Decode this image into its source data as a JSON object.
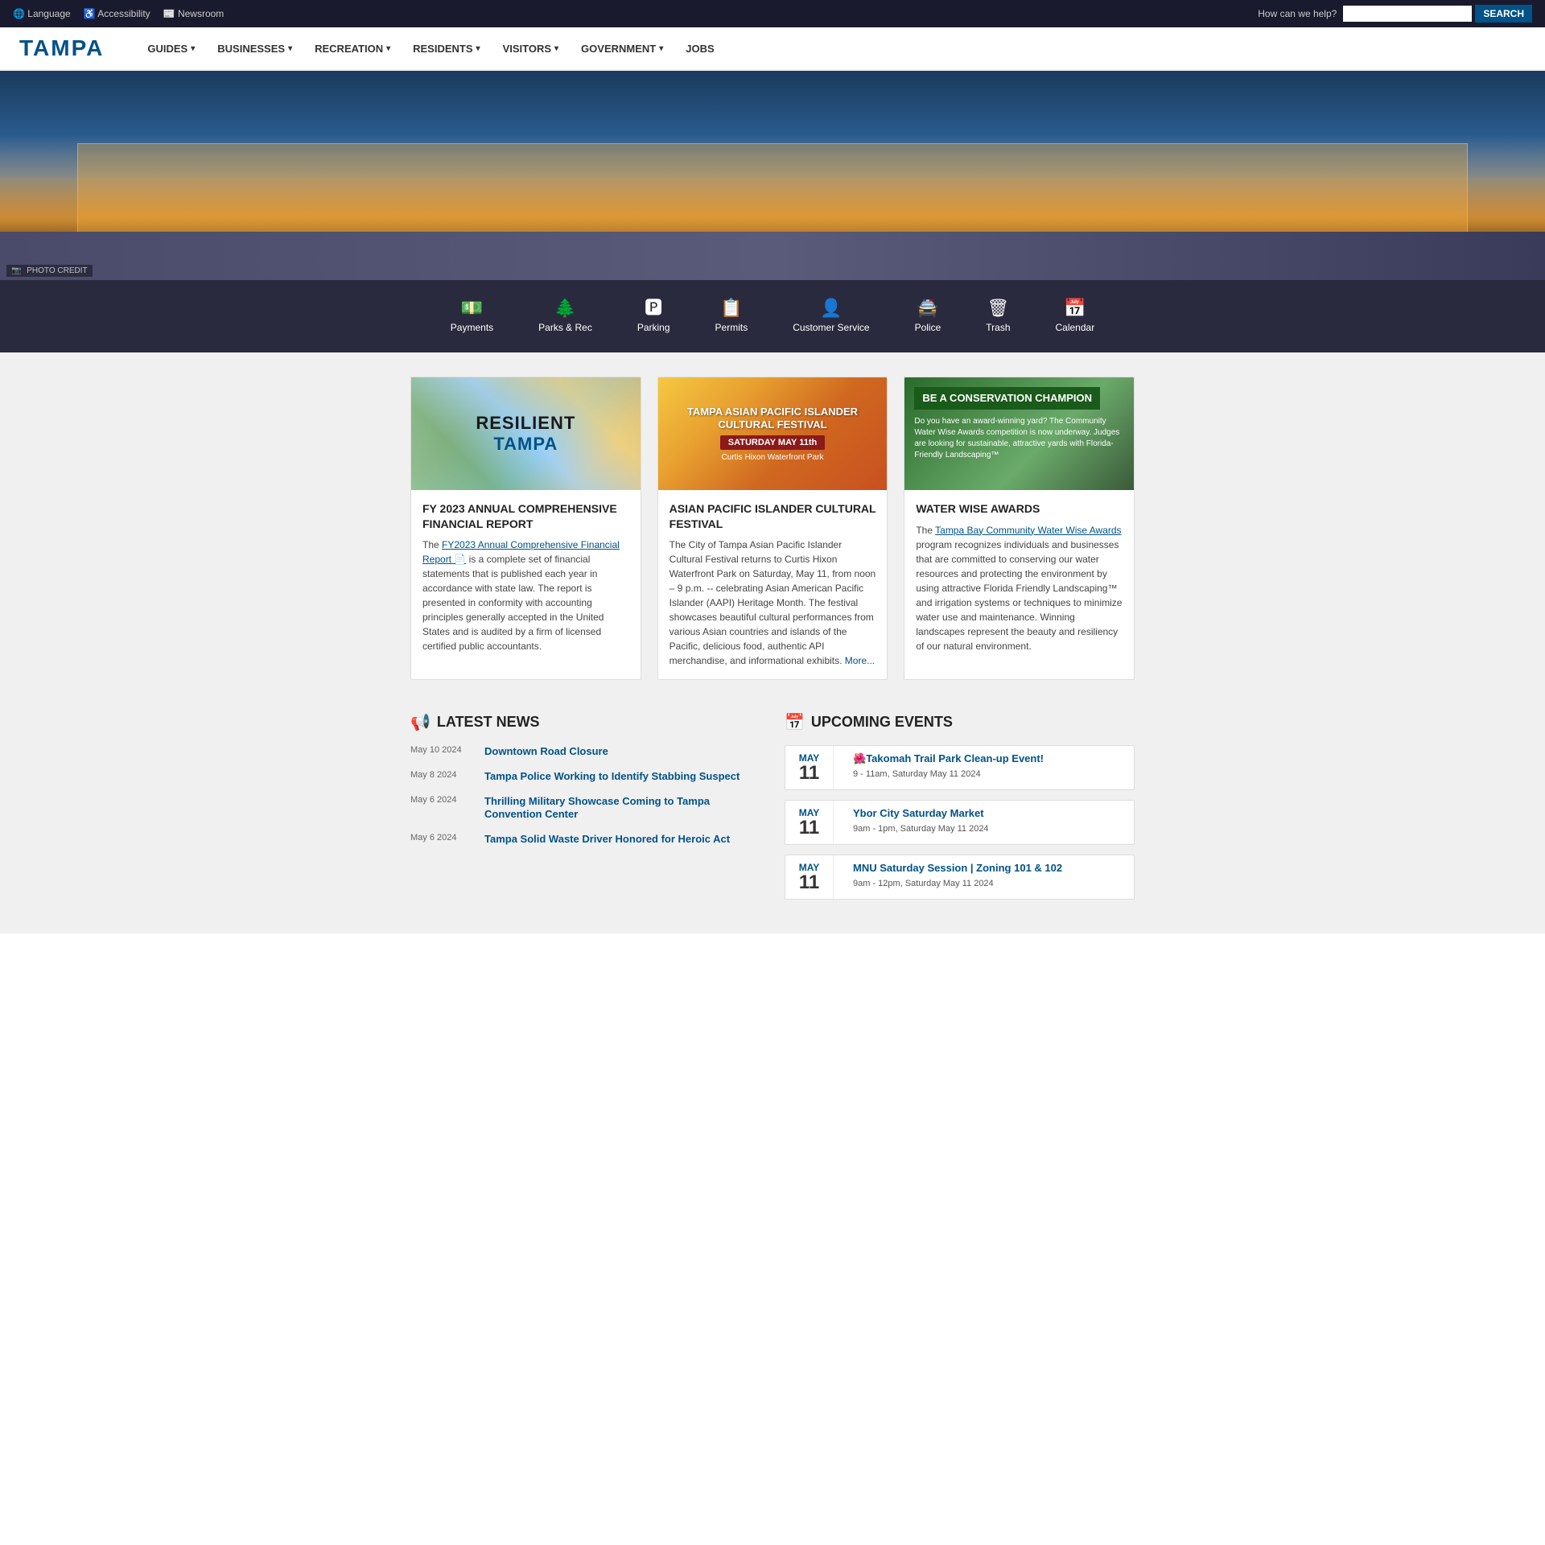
{
  "topbar": {
    "language_label": "Language",
    "accessibility_label": "Accessibility",
    "newsroom_label": "Newsroom",
    "search_placeholder": "How can we help?",
    "search_button_label": "SEARCH"
  },
  "header": {
    "logo": "TAMPA",
    "nav": [
      {
        "label": "GUIDES",
        "has_dropdown": true
      },
      {
        "label": "BUSINESSES",
        "has_dropdown": true
      },
      {
        "label": "RECREATION",
        "has_dropdown": true
      },
      {
        "label": "RESIDENTS",
        "has_dropdown": true
      },
      {
        "label": "VISITORS",
        "has_dropdown": true
      },
      {
        "label": "GOVERNMENT",
        "has_dropdown": true
      },
      {
        "label": "JOBS",
        "has_dropdown": false
      }
    ]
  },
  "hero": {
    "photo_credit_label": "PHOTO CREDIT"
  },
  "quick_links": [
    {
      "label": "Payments",
      "icon": "💵"
    },
    {
      "label": "Parks & Rec",
      "icon": "🌲"
    },
    {
      "label": "Parking",
      "icon": "🅿"
    },
    {
      "label": "Permits",
      "icon": "📋"
    },
    {
      "label": "Customer Service",
      "icon": "👤"
    },
    {
      "label": "Police",
      "icon": "🚔"
    },
    {
      "label": "Trash",
      "icon": "🗑"
    },
    {
      "label": "Calendar",
      "icon": "📅"
    }
  ],
  "news_cards": [
    {
      "img_type": "resilient",
      "resilient_line1": "RESILIENT",
      "resilient_line2": "TAMPA",
      "title": "FY 2023 ANNUAL COMPREHENSIVE FINANCIAL REPORT",
      "text": "The ",
      "link_text": "FY2023 Annual Comprehensive Financial Report",
      "link_suffix": " is a complete set of financial statements that is published each year in accordance with state law. The report is presented in conformity with accounting principles generally accepted in the United States and is audited by a firm of licensed certified public accountants."
    },
    {
      "img_type": "festival",
      "festival_title": "TAMPA ASIAN PACIFIC ISLANDER CULTURAL FESTIVAL",
      "festival_date": "SATURDAY MAY 11th",
      "festival_venue": "Curtis Hixon Waterfront Park",
      "title": "ASIAN PACIFIC ISLANDER CULTURAL FESTIVAL",
      "text": "The City of Tampa Asian Pacific Islander Cultural Festival returns to Curtis Hixon Waterfront Park on Saturday, May 11, from noon – 9 p.m. -- celebrating Asian American Pacific Islander (AAPI) Heritage Month. The festival showcases beautiful cultural performances from various Asian countries and islands of the Pacific, delicious food, authentic API merchandise, and informational exhibits.",
      "more_link": "More..."
    },
    {
      "img_type": "conservation",
      "conservation_title": "BE A CONSERVATION CHAMPION",
      "conservation_sub": "Do you have an award-winning yard? The Community Water Wise Awards competition is now underway. Judges are looking for sustainable, attractive yards with Florida-Friendly Landscaping™",
      "title": "WATER WISE AWARDS",
      "text": "The ",
      "link_text": "Tampa Bay Community Water Wise Awards",
      "link_suffix": " program recognizes individuals and businesses that are committed to conserving our water resources and protecting the environment by using attractive Florida Friendly Landscaping™ and irrigation systems or techniques to minimize water use and maintenance. Winning landscapes represent the beauty and resiliency of our natural environment."
    }
  ],
  "latest_news": {
    "section_title": "LATEST NEWS",
    "section_icon": "📢",
    "items": [
      {
        "date": "May 10 2024",
        "label": "Downtown Road Closure"
      },
      {
        "date": "May 8 2024",
        "label": "Tampa Police Working to Identify Stabbing Suspect"
      },
      {
        "date": "May 6 2024",
        "label": "Thrilling Military Showcase Coming to Tampa Convention Center"
      },
      {
        "date": "May 6 2024",
        "label": "Tampa Solid Waste Driver Honored for Heroic Act"
      }
    ]
  },
  "upcoming_events": {
    "section_title": "UPCOMING EVENTS",
    "section_icon": "📅",
    "items": [
      {
        "month": "May",
        "day": "11",
        "title": "Takomah Trail Park Clean-up Event!",
        "emoji": "🌺",
        "time": "9 - 11am, Saturday May 11 2024"
      },
      {
        "month": "May",
        "day": "11",
        "title": "Ybor City Saturday Market",
        "emoji": "",
        "time": "9am - 1pm, Saturday May 11 2024"
      },
      {
        "month": "May",
        "day": "11",
        "title": "MNU Saturday Session | Zoning 101 & 102",
        "emoji": "",
        "time": "9am - 12pm, Saturday May 11 2024"
      }
    ]
  }
}
